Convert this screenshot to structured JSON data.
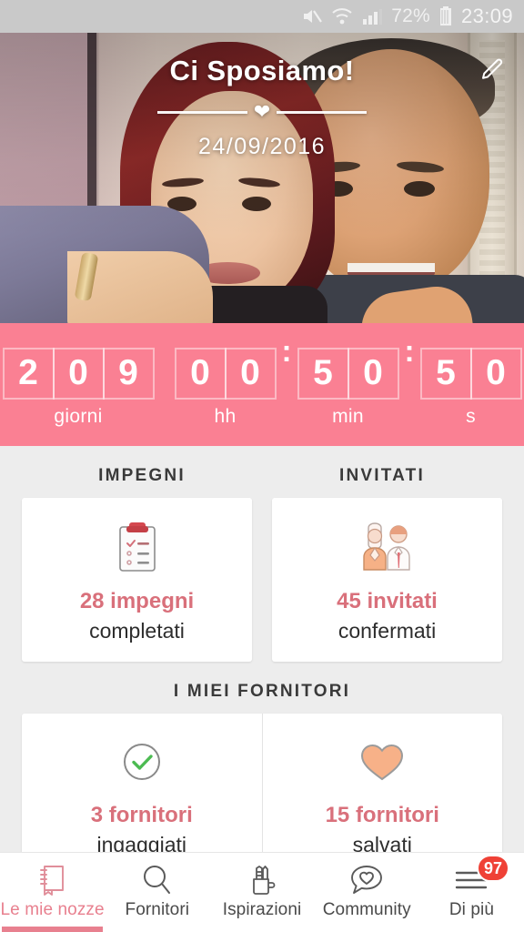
{
  "statusbar": {
    "icons": [
      "mute-icon",
      "wifi-icon",
      "signal-icon",
      "battery-icon"
    ],
    "battery": "72%",
    "time": "23:09"
  },
  "hero": {
    "title": "Ci Sposiamo!",
    "date": "24/09/2016",
    "divider_icon": "heart-icon",
    "edit_icon": "pencil-icon"
  },
  "countdown": {
    "background": "#fa8093",
    "days": {
      "digits": [
        "2",
        "0",
        "9"
      ],
      "label": "giorni"
    },
    "hours": {
      "digits": [
        "0",
        "0"
      ],
      "label": "hh"
    },
    "minutes": {
      "digits": [
        "5",
        "0"
      ],
      "label": "min"
    },
    "seconds": {
      "digits": [
        "5",
        "0"
      ],
      "label": "s"
    },
    "separator": ":"
  },
  "sections": {
    "tasks_title": "IMPEGNI",
    "guests_title": "INVITATI",
    "suppliers_title": "I MIEI FORNITORI"
  },
  "cards": {
    "tasks": {
      "icon": "clipboard-checklist-icon",
      "count": "28 impegni",
      "sub": "completati"
    },
    "guests": {
      "icon": "bride-groom-icon",
      "count": "45 invitati",
      "sub": "confermati"
    },
    "suppliers_hired": {
      "icon": "check-circle-icon",
      "count": "3 fornitori",
      "sub": "ingaggiati"
    },
    "suppliers_saved": {
      "icon": "heart-filled-icon",
      "count": "15 fornitori",
      "sub": "salvati"
    }
  },
  "accent": {
    "count_color": "#d9707b",
    "nav_active": "#e8808f",
    "badge_color": "#ef4136"
  },
  "bottomnav": {
    "items": [
      {
        "label": "Le mie nozze",
        "icon": "notebook-icon",
        "active": true
      },
      {
        "label": "Fornitori",
        "icon": "search-icon",
        "active": false
      },
      {
        "label": "Ispirazioni",
        "icon": "pencil-cup-icon",
        "active": false
      },
      {
        "label": "Community",
        "icon": "chat-heart-icon",
        "active": false
      },
      {
        "label": "Di più",
        "icon": "hamburger-icon",
        "active": false,
        "badge": "97"
      }
    ]
  }
}
